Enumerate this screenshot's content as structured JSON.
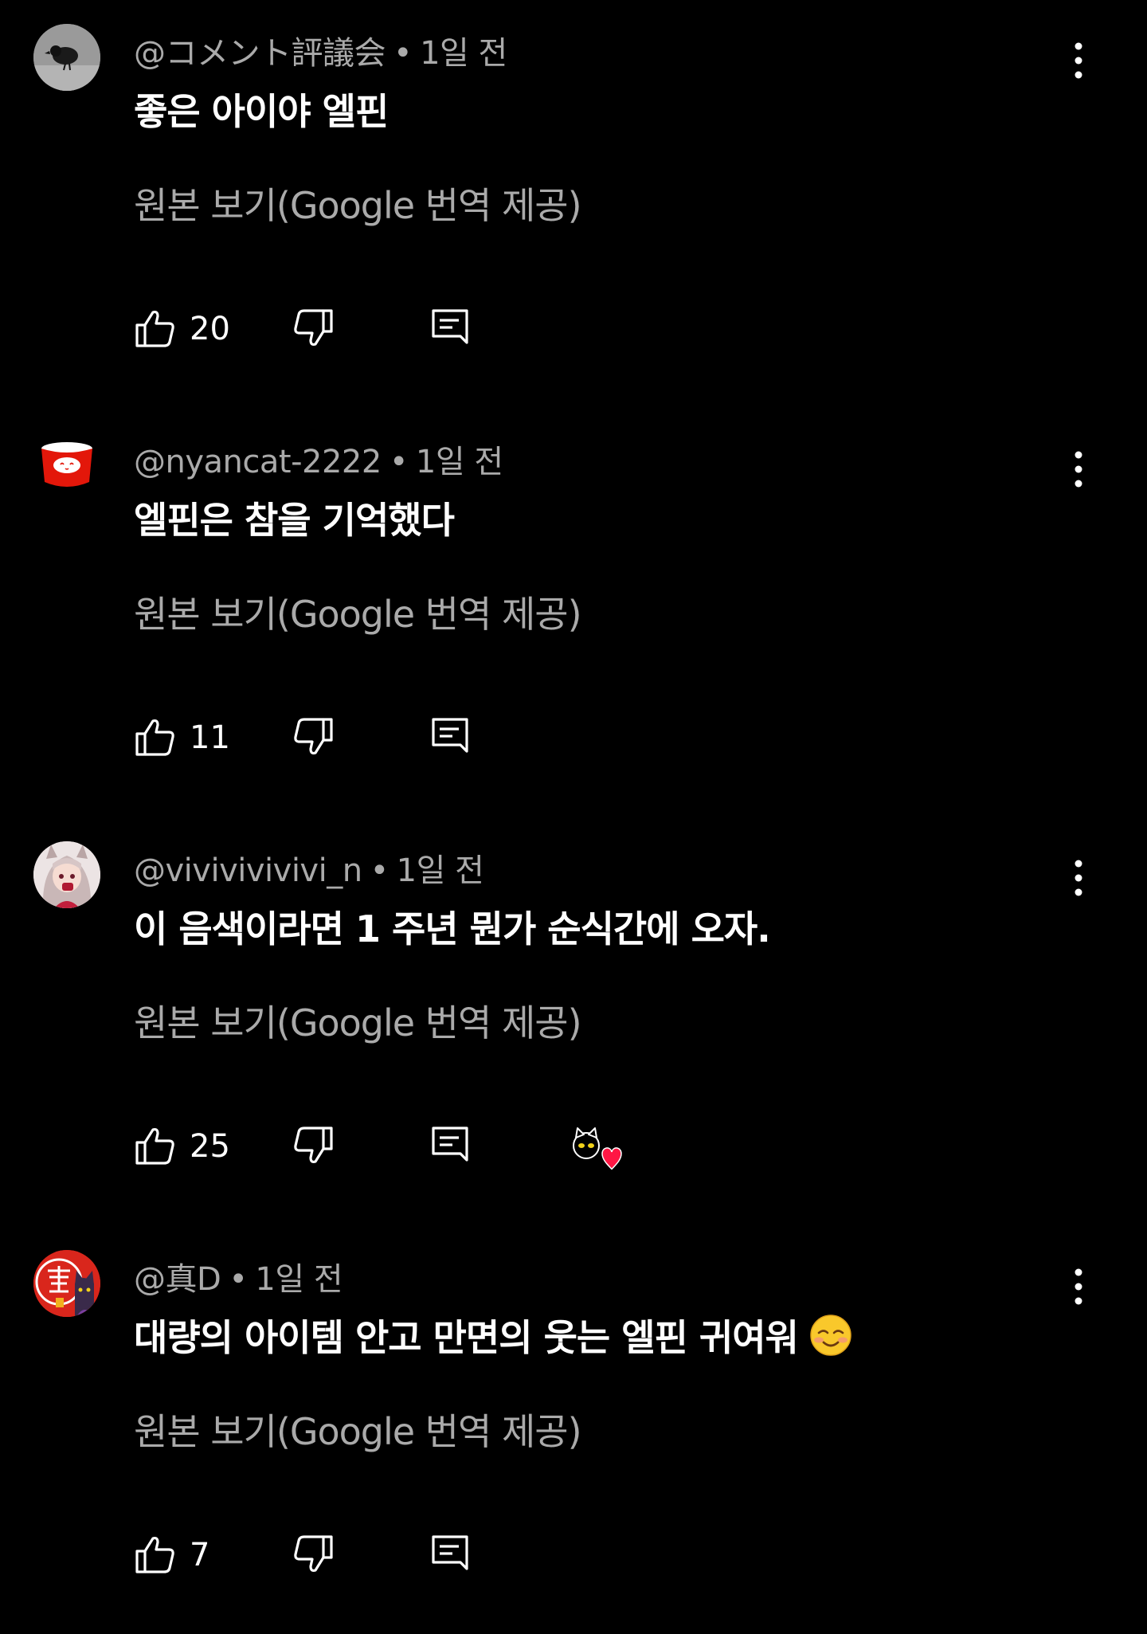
{
  "translate_label": "원본 보기(Google 번역 제공)",
  "comments": [
    {
      "author": "@コメント評議会",
      "time": "1일 전",
      "text": "좋은 아이야 엘핀",
      "likes": "20",
      "avatar": "crow-photo-avatar",
      "emoji": "",
      "heart": false
    },
    {
      "author": "@nyancat-2222",
      "time": "1일 전",
      "text": "엘핀은 참을 기억했다",
      "likes": "11",
      "avatar": "red-cup-cat-avatar",
      "emoji": "",
      "heart": false
    },
    {
      "author": "@vivivivivivi_n",
      "time": "1일 전",
      "text": "이 음색이라면 1 주년 뭔가 순식간에 오자.",
      "likes": "25",
      "avatar": "anime-girl-avatar",
      "emoji": "",
      "heart": true
    },
    {
      "author": "@真D",
      "time": "1일 전",
      "text": "대량의 아이템 안고 만면의 웃는 엘핀 귀여워",
      "likes": "7",
      "avatar": "red-seal-cat-avatar",
      "emoji": "smiling-face-emoji",
      "heart": false
    }
  ],
  "colors": {
    "background": "#000000",
    "primary_text": "#ffffff",
    "secondary_text": "#aaaaaa",
    "heart": "#ff1744"
  }
}
